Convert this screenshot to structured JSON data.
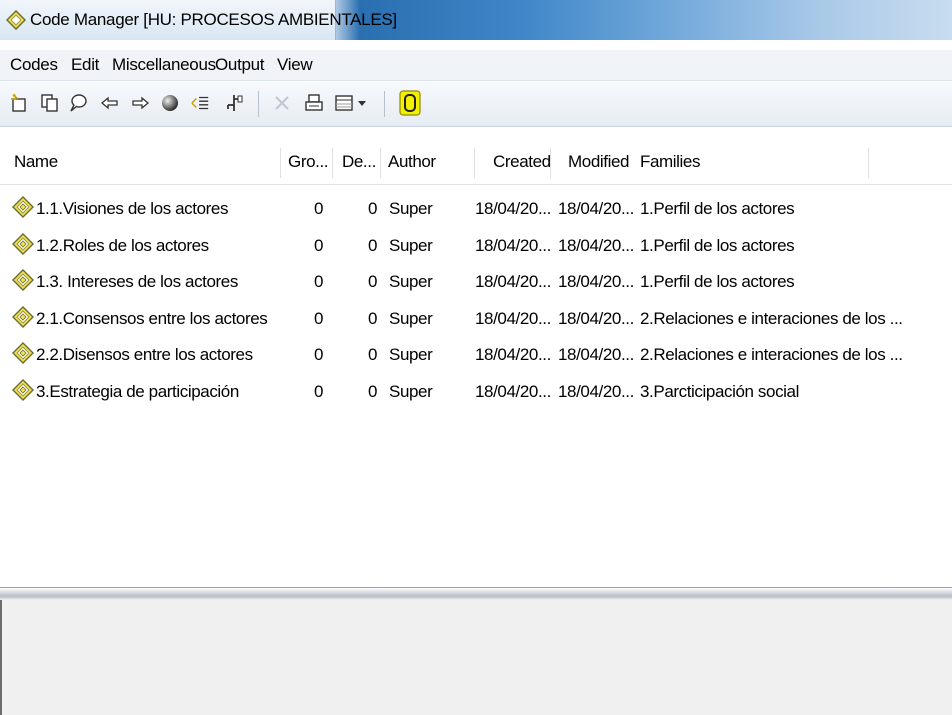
{
  "window": {
    "title": "Code Manager [HU: PROCESOS AMBIENTALES]",
    "icon": "code-diamond-icon"
  },
  "menu": [
    "Codes",
    "Edit",
    "Miscellaneous",
    "Output",
    "View"
  ],
  "toolbar": {
    "icons": [
      "new-code-icon",
      "copy-code-icon",
      "comment-icon",
      "back-arrow-icon",
      "forward-arrow-icon",
      "sphere-icon",
      "filter-icon",
      "tree-icon",
      "delete-icon",
      "print-icon",
      "grid-view-icon",
      "dropdown-arrow-icon",
      "code-highlight-icon"
    ]
  },
  "columns": {
    "name": "Name",
    "grounded": "Gro...",
    "density": "De...",
    "author": "Author",
    "created": "Created",
    "modified": "Modified",
    "families": "Families"
  },
  "rows": [
    {
      "name": "1.1.Visiones de los actores",
      "grounded": "0",
      "density": "0",
      "author": "Super",
      "created": "18/04/20...",
      "modified": "18/04/20...",
      "families": "1.Perfil de los actores"
    },
    {
      "name": "1.2.Roles de los actores",
      "grounded": "0",
      "density": "0",
      "author": "Super",
      "created": "18/04/20...",
      "modified": "18/04/20...",
      "families": "1.Perfil de los actores"
    },
    {
      "name": "1.3. Intereses de los actores",
      "grounded": "0",
      "density": "0",
      "author": "Super",
      "created": "18/04/20...",
      "modified": "18/04/20...",
      "families": "1.Perfil de los actores"
    },
    {
      "name": "2.1.Consensos entre los actores",
      "grounded": "0",
      "density": "0",
      "author": "Super",
      "created": "18/04/20...",
      "modified": "18/04/20...",
      "families": "2.Relaciones e interaciones de los ..."
    },
    {
      "name": "2.2.Disensos entre los actores",
      "grounded": "0",
      "density": "0",
      "author": "Super",
      "created": "18/04/20...",
      "modified": "18/04/20...",
      "families": "2.Relaciones e interaciones de los ..."
    },
    {
      "name": "3.Estrategia de participación",
      "grounded": "0",
      "density": "0",
      "author": "Super",
      "created": "18/04/20...",
      "modified": "18/04/20...",
      "families": "3.Parcticipación social"
    }
  ]
}
